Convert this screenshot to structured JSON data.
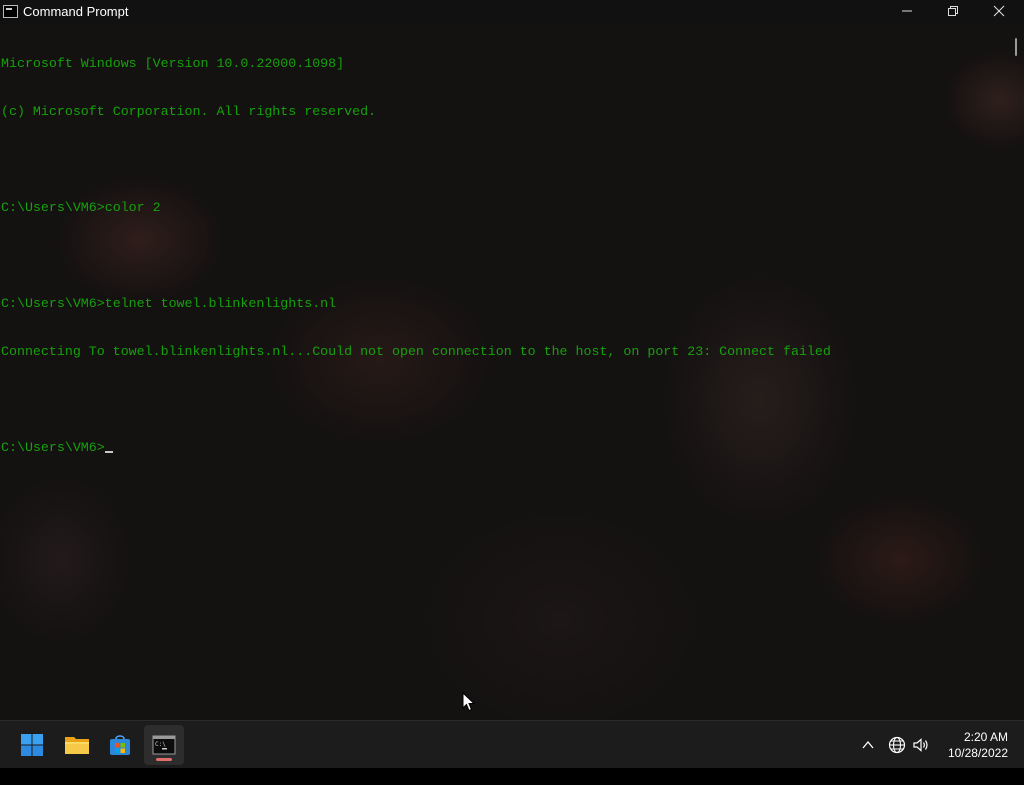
{
  "window": {
    "title": "Command Prompt",
    "controls": {
      "minimize": "minimize",
      "maximize": "restore",
      "close": "close"
    }
  },
  "console": {
    "text_color": "#16a00c",
    "lines": [
      "Microsoft Windows [Version 10.0.22000.1098]",
      "(c) Microsoft Corporation. All rights reserved.",
      "",
      "C:\\Users\\VM6>color 2",
      "",
      "C:\\Users\\VM6>telnet towel.blinkenlights.nl",
      "Connecting To towel.blinkenlights.nl...Could not open connection to the host, on port 23: Connect failed",
      "",
      "C:\\Users\\VM6>"
    ]
  },
  "taskbar": {
    "apps": [
      {
        "name": "start",
        "icon": "windows-logo-icon"
      },
      {
        "name": "file-explorer",
        "icon": "folder-icon"
      },
      {
        "name": "microsoft-store",
        "icon": "store-bag-icon"
      },
      {
        "name": "command-prompt",
        "icon": "terminal-icon",
        "active": true
      }
    ],
    "tray": {
      "icons": [
        "chevron-up-icon",
        "globe-icon",
        "speaker-icon"
      ],
      "time": "2:20 AM",
      "date": "10/28/2022"
    },
    "active_color": "#e06c6c"
  }
}
